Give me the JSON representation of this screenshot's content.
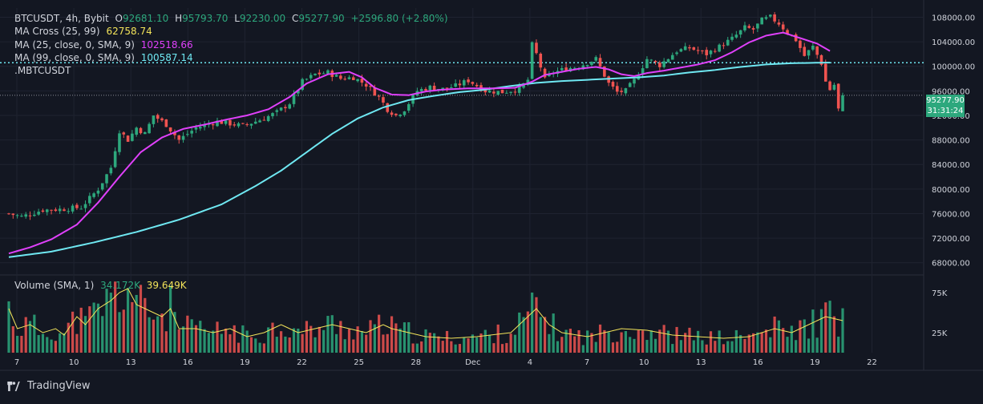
{
  "header": {
    "symbol_line": "BTCUSDT, 4h, Bybit",
    "open_label": "O",
    "open": "92681.10",
    "high_label": "H",
    "high": "95793.70",
    "low_label": "L",
    "low": "92230.00",
    "close_label": "C",
    "close": "95277.90",
    "change": "+2596.80 (+2.80%)"
  },
  "indicators": [
    {
      "label": "MA Cross (25, 99)",
      "value": "62758.74",
      "color": "#f2e35a"
    },
    {
      "label": "MA (25, close, 0, SMA, 9)",
      "value": "102518.66",
      "color": "#e040fb"
    },
    {
      "label": "MA (99, close, 0, SMA, 9)",
      "value": "100587.14",
      "color": "#6fe8f2"
    },
    {
      "label": ".MBTCUSDT",
      "value": "",
      "color": "#d1d4dc"
    }
  ],
  "volume_legend": {
    "label": "Volume (SMA, 1)",
    "value1": "34.172K",
    "value2": "39.649K"
  },
  "price_tag": {
    "price": "95277.90",
    "countdown": "31:31:24"
  },
  "brand": {
    "name": "TradingView"
  },
  "colors": {
    "up": "#2da87d",
    "down": "#ef5350",
    "ma25": "#e040fb",
    "ma99": "#6fe8f2",
    "vol_sma": "#f2e35a",
    "bg": "#131722",
    "grid": "#1f2330",
    "text": "#d1d4dc"
  },
  "chart_data": {
    "type": "candlestick",
    "title": "BTCUSDT, 4h, Bybit",
    "y_axis": {
      "ticks": [
        "108000.00",
        "104000.00",
        "100000.00",
        "96000.00",
        "92000.00",
        "88000.00",
        "84000.00",
        "80000.00",
        "76000.00",
        "72000.00",
        "68000.00"
      ],
      "range": [
        66000,
        109500
      ]
    },
    "x_axis": {
      "ticks": [
        "7",
        "10",
        "13",
        "16",
        "19",
        "22",
        "25",
        "28",
        "Dec",
        "4",
        "7",
        "10",
        "13",
        "16",
        "19",
        "22"
      ]
    },
    "volume_axis": {
      "ticks": [
        "75K",
        "25K"
      ]
    },
    "reference_line": 100587,
    "current_price": 95277.9,
    "price_path": [
      [
        0,
        76000
      ],
      [
        3,
        75500
      ],
      [
        8,
        76600
      ],
      [
        12,
        76700
      ],
      [
        17,
        77000
      ],
      [
        21,
        80000
      ],
      [
        24,
        83500
      ],
      [
        26,
        89500
      ],
      [
        28,
        88000
      ],
      [
        30,
        90000
      ],
      [
        32,
        89000
      ],
      [
        34,
        92000
      ],
      [
        37,
        90500
      ],
      [
        40,
        88000
      ],
      [
        44,
        90000
      ],
      [
        49,
        91000
      ],
      [
        55,
        90300
      ],
      [
        60,
        91500
      ],
      [
        63,
        92500
      ],
      [
        66,
        94000
      ],
      [
        69,
        97500
      ],
      [
        72,
        98700
      ],
      [
        75,
        99000
      ],
      [
        78,
        98000
      ],
      [
        81,
        98200
      ],
      [
        84,
        97000
      ],
      [
        87,
        95000
      ],
      [
        89,
        93000
      ],
      [
        91,
        92000
      ],
      [
        93,
        93000
      ],
      [
        96,
        96000
      ],
      [
        99,
        96600
      ],
      [
        102,
        96300
      ],
      [
        105,
        96800
      ],
      [
        108,
        97700
      ],
      [
        112,
        96000
      ],
      [
        116,
        95800
      ],
      [
        120,
        96300
      ],
      [
        122,
        97800
      ],
      [
        123,
        103500
      ],
      [
        124,
        102000
      ],
      [
        126,
        97800
      ],
      [
        128,
        99000
      ],
      [
        131,
        99600
      ],
      [
        134,
        100000
      ],
      [
        138,
        101200
      ],
      [
        141,
        97200
      ],
      [
        143,
        95800
      ],
      [
        145,
        96000
      ],
      [
        147,
        97700
      ],
      [
        150,
        101200
      ],
      [
        153,
        100200
      ],
      [
        157,
        102500
      ],
      [
        160,
        103000
      ],
      [
        164,
        102000
      ],
      [
        167,
        103200
      ],
      [
        170,
        104500
      ],
      [
        173,
        106300
      ],
      [
        175,
        106000
      ],
      [
        177,
        107500
      ],
      [
        179,
        108000
      ],
      [
        181,
        107000
      ],
      [
        183,
        105500
      ],
      [
        185,
        104300
      ],
      [
        187,
        101700
      ],
      [
        189,
        103200
      ],
      [
        191,
        100500
      ],
      [
        192,
        97500
      ],
      [
        193,
        96200
      ],
      [
        194,
        97000
      ],
      [
        195,
        93000
      ],
      [
        196,
        95277.9
      ]
    ],
    "ma25_path": [
      [
        0,
        69500
      ],
      [
        5,
        70500
      ],
      [
        10,
        71800
      ],
      [
        16,
        74200
      ],
      [
        21,
        77800
      ],
      [
        26,
        82000
      ],
      [
        31,
        86000
      ],
      [
        36,
        88400
      ],
      [
        41,
        89800
      ],
      [
        46,
        90500
      ],
      [
        51,
        91300
      ],
      [
        56,
        92000
      ],
      [
        61,
        93000
      ],
      [
        66,
        95000
      ],
      [
        70,
        97200
      ],
      [
        75,
        98700
      ],
      [
        80,
        99100
      ],
      [
        83,
        98200
      ],
      [
        86,
        96500
      ],
      [
        90,
        95400
      ],
      [
        94,
        95300
      ],
      [
        98,
        95900
      ],
      [
        102,
        96200
      ],
      [
        108,
        96400
      ],
      [
        114,
        96400
      ],
      [
        119,
        96500
      ],
      [
        123,
        97500
      ],
      [
        126,
        98600
      ],
      [
        130,
        99100
      ],
      [
        134,
        99600
      ],
      [
        138,
        99900
      ],
      [
        141,
        99500
      ],
      [
        144,
        98700
      ],
      [
        147,
        98400
      ],
      [
        150,
        98900
      ],
      [
        154,
        99300
      ],
      [
        158,
        99800
      ],
      [
        162,
        100300
      ],
      [
        166,
        101000
      ],
      [
        170,
        102300
      ],
      [
        174,
        103900
      ],
      [
        178,
        105000
      ],
      [
        182,
        105500
      ],
      [
        186,
        104600
      ],
      [
        190,
        103700
      ],
      [
        193,
        102500
      ]
    ],
    "ma99_path": [
      [
        0,
        68900
      ],
      [
        10,
        69800
      ],
      [
        20,
        71300
      ],
      [
        30,
        73000
      ],
      [
        40,
        75000
      ],
      [
        50,
        77500
      ],
      [
        58,
        80500
      ],
      [
        64,
        83000
      ],
      [
        70,
        86000
      ],
      [
        76,
        89000
      ],
      [
        82,
        91500
      ],
      [
        88,
        93300
      ],
      [
        94,
        94500
      ],
      [
        100,
        95200
      ],
      [
        106,
        95800
      ],
      [
        112,
        96200
      ],
      [
        118,
        96800
      ],
      [
        124,
        97300
      ],
      [
        130,
        97600
      ],
      [
        136,
        97800
      ],
      [
        142,
        98000
      ],
      [
        148,
        98200
      ],
      [
        154,
        98500
      ],
      [
        160,
        99000
      ],
      [
        166,
        99400
      ],
      [
        172,
        99900
      ],
      [
        178,
        100300
      ],
      [
        184,
        100500
      ],
      [
        190,
        100587
      ],
      [
        193,
        100600
      ]
    ],
    "volume_profile": [
      [
        0,
        55
      ],
      [
        2,
        30
      ],
      [
        5,
        35
      ],
      [
        8,
        25
      ],
      [
        11,
        30
      ],
      [
        13,
        22
      ],
      [
        16,
        45
      ],
      [
        18,
        35
      ],
      [
        21,
        55
      ],
      [
        24,
        65
      ],
      [
        26,
        75
      ],
      [
        28,
        80
      ],
      [
        30,
        60
      ],
      [
        32,
        55
      ],
      [
        34,
        50
      ],
      [
        36,
        45
      ],
      [
        38,
        55
      ],
      [
        40,
        30
      ],
      [
        44,
        30
      ],
      [
        48,
        25
      ],
      [
        52,
        30
      ],
      [
        56,
        20
      ],
      [
        60,
        25
      ],
      [
        64,
        35
      ],
      [
        68,
        25
      ],
      [
        72,
        30
      ],
      [
        76,
        35
      ],
      [
        80,
        30
      ],
      [
        84,
        25
      ],
      [
        88,
        35
      ],
      [
        90,
        30
      ],
      [
        94,
        25
      ],
      [
        98,
        20
      ],
      [
        104,
        18
      ],
      [
        110,
        20
      ],
      [
        118,
        25
      ],
      [
        122,
        45
      ],
      [
        124,
        55
      ],
      [
        127,
        35
      ],
      [
        130,
        25
      ],
      [
        136,
        20
      ],
      [
        140,
        25
      ],
      [
        144,
        30
      ],
      [
        150,
        28
      ],
      [
        156,
        22
      ],
      [
        162,
        20
      ],
      [
        168,
        18
      ],
      [
        174,
        20
      ],
      [
        180,
        30
      ],
      [
        184,
        25
      ],
      [
        188,
        35
      ],
      [
        192,
        45
      ],
      [
        196,
        40
      ]
    ]
  }
}
